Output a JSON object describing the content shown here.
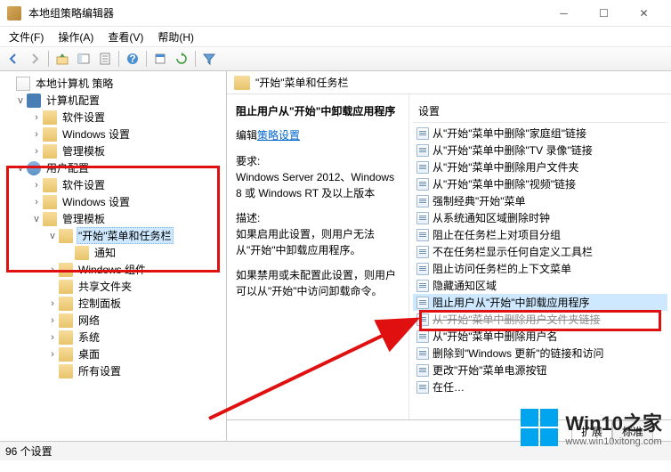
{
  "window": {
    "title": "本地组策略编辑器"
  },
  "menubar": {
    "file": "文件(F)",
    "action": "操作(A)",
    "view": "查看(V)",
    "help": "帮助(H)"
  },
  "tree": {
    "root": "本地计算机 策略",
    "computer_config": "计算机配置",
    "cc_software": "软件设置",
    "cc_windows": "Windows 设置",
    "cc_admin": "管理模板",
    "user_config": "用户配置",
    "uc_software": "软件设置",
    "uc_windows": "Windows 设置",
    "uc_admin": "管理模板",
    "start_taskbar": "\"开始\"菜单和任务栏",
    "notify": "通知",
    "win_components": "Windows 组件",
    "shared_folders": "共享文件夹",
    "control_panel": "控制面板",
    "network": "网络",
    "system": "系统",
    "desktop": "桌面",
    "all_settings": "所有设置"
  },
  "path": "\"开始\"菜单和任务栏",
  "detail": {
    "title": "阻止用户从\"开始\"中卸载应用程序",
    "edit_prefix": "编辑",
    "edit_link": "策略设置",
    "req_label": "要求:",
    "req_text": "Windows Server 2012、Windows 8 或 Windows RT 及以上版本",
    "desc_label": "描述:",
    "desc1": "如果启用此设置，则用户无法从\"开始\"中卸载应用程序。",
    "desc2": "如果禁用或未配置此设置，则用户可以从\"开始\"中访问卸载命令。"
  },
  "settings": {
    "header": "设置",
    "items": [
      "从\"开始\"菜单中删除\"家庭组\"链接",
      "从\"开始\"菜单中删除\"TV 录像\"链接",
      "从\"开始\"菜单中删除用户文件夹",
      "从\"开始\"菜单中删除\"视频\"链接",
      "强制经典\"开始\"菜单",
      "从系统通知区域删除时钟",
      "阻止在任务栏上对项目分组",
      "不在任务栏显示任何自定义工具栏",
      "阻止访问任务栏的上下文菜单",
      "隐藏通知区域",
      "阻止用户从\"开始\"中卸载应用程序",
      "从\"开始\"菜单中删除用户文件夹链接",
      "从\"开始\"菜单中删除用户名",
      "删除到\"Windows 更新\"的链接和访问",
      "更改\"开始\"菜单电源按钮",
      "在任…"
    ],
    "selected_index": 10
  },
  "tabs": {
    "extended": "扩展",
    "standard": "标准"
  },
  "statusbar": "96 个设置",
  "watermark": {
    "brand": "Win10之家",
    "url": "www.win10xitong.com"
  }
}
